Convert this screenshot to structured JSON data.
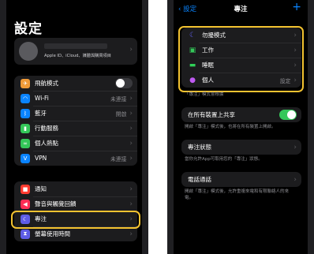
{
  "left": {
    "title": "設定",
    "profile": {
      "name": "",
      "subtitle": "Apple ID、iCloud、媒體與購買項目"
    },
    "group1": [
      {
        "label": "飛航模式",
        "icon": "airplane-icon",
        "color": "#f09a37",
        "glyph": "✈",
        "toggle": "off"
      },
      {
        "label": "Wi-Fi",
        "icon": "wifi-icon",
        "color": "#0a84ff",
        "glyph": "◠",
        "value": "未連接"
      },
      {
        "label": "藍牙",
        "icon": "bluetooth-icon",
        "color": "#0a84ff",
        "glyph": "ᛒ",
        "value": "開啟"
      },
      {
        "label": "行動服務",
        "icon": "cellular-icon",
        "color": "#34c759",
        "glyph": "▮"
      },
      {
        "label": "個人熱點",
        "icon": "hotspot-icon",
        "color": "#34c759",
        "glyph": "∞"
      },
      {
        "label": "VPN",
        "icon": "vpn-icon",
        "color": "#0a84ff",
        "glyph": "V",
        "value": "未連接"
      }
    ],
    "group2": [
      {
        "label": "通知",
        "icon": "notifications-icon",
        "color": "#ff3b30",
        "glyph": "■"
      },
      {
        "label": "聲音與觸覺回饋",
        "icon": "sound-icon",
        "color": "#ff2d55",
        "glyph": "◀"
      },
      {
        "label": "專注",
        "icon": "focus-moon-icon",
        "color": "#5e5ce6",
        "glyph": "☾"
      },
      {
        "label": "螢幕使用時間",
        "icon": "screen-time-icon",
        "color": "#5e5ce6",
        "glyph": "⧗"
      }
    ]
  },
  "right": {
    "back_label": "設定",
    "title": "專注",
    "add_label": "+",
    "focus_modes": [
      {
        "label": "勿擾模式",
        "icon": "moon-icon",
        "color": "#5e5ce6",
        "glyph": "☾"
      },
      {
        "label": "工作",
        "icon": "work-badge-icon",
        "color": "#34c759",
        "glyph": "▣"
      },
      {
        "label": "睡眠",
        "icon": "bed-icon",
        "color": "#30d158",
        "glyph": "▬"
      },
      {
        "label": "個人",
        "icon": "person-icon",
        "color": "#bf5af2",
        "glyph": "●",
        "value": "設定"
      }
    ],
    "focus_note": "「專注」模式會根據",
    "share_label": "在所有裝置上共享",
    "share_note": "開啟「專注」模式後，也將在所有裝置上開啟。",
    "status_label": "專注狀態",
    "status_note": "當你允許App可取用您的「專注」狀態。",
    "calls_label": "電話通話",
    "calls_note": "開啟「專注」模式後，允許重複來電和有限聯絡人的來電。"
  },
  "colors": {
    "highlight": "#f2c230",
    "toggle_on": "#34c759",
    "toggle_off": "#39393d",
    "link": "#0a84ff"
  }
}
